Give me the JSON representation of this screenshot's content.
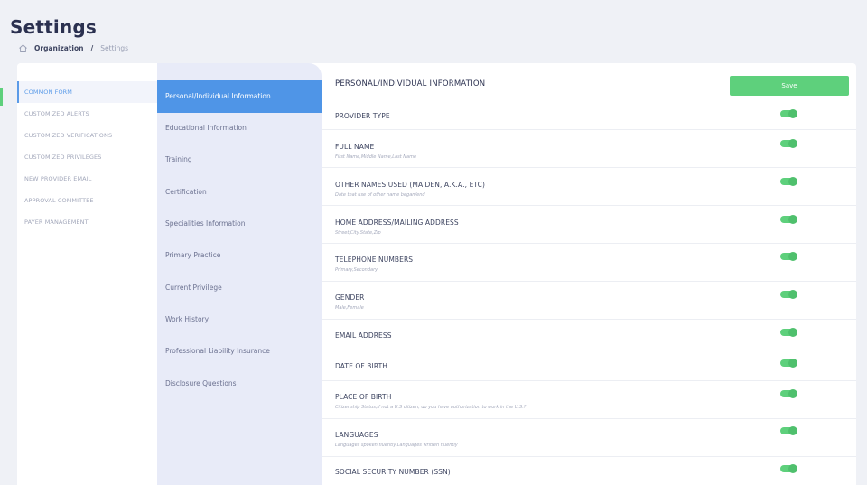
{
  "page": {
    "title": "Settings"
  },
  "breadcrumb": {
    "home_icon": "home-icon",
    "org": "Organization",
    "separator": "/",
    "current": "Settings"
  },
  "colors": {
    "accent_blue": "#4f95e7",
    "accent_green": "#5ed07c"
  },
  "sidebar": {
    "items": [
      {
        "label": "COMMON FORM",
        "active": true
      },
      {
        "label": "CUSTOMIZED ALERTS"
      },
      {
        "label": "CUSTOMIZED VERIFICATIONS"
      },
      {
        "label": "CUSTOMIZED PRIVILEGES"
      },
      {
        "label": "NEW PROVIDER EMAIL"
      },
      {
        "label": "APPROVAL COMMITTEE"
      },
      {
        "label": "PAYER MANAGEMENT"
      }
    ]
  },
  "sections": {
    "items": [
      {
        "label": "Personal/Individual Information",
        "active": true
      },
      {
        "label": "Educational Information"
      },
      {
        "label": "Training"
      },
      {
        "label": "Certification"
      },
      {
        "label": "Specialities Information"
      },
      {
        "label": "Primary Practice"
      },
      {
        "label": "Current Privilege"
      },
      {
        "label": "Work History"
      },
      {
        "label": "Professional Liability Insurance"
      },
      {
        "label": "Disclosure Questions"
      }
    ]
  },
  "main": {
    "title": "PERSONAL/INDIVIDUAL INFORMATION",
    "save_label": "Save",
    "fields": [
      {
        "label": "PROVIDER TYPE",
        "sub": "",
        "enabled": true
      },
      {
        "label": "FULL NAME",
        "sub": "First Name,Middle Name,Last Name",
        "enabled": true
      },
      {
        "label": "OTHER NAMES USED (MAIDEN, A.K.A., ETC)",
        "sub": "Date that use of other name began/end",
        "enabled": true
      },
      {
        "label": "HOME ADDRESS/MAILING ADDRESS",
        "sub": "Street,City,State,Zip",
        "enabled": true
      },
      {
        "label": "TELEPHONE NUMBERS",
        "sub": "Primary,Secondary",
        "enabled": true
      },
      {
        "label": "GENDER",
        "sub": "Male,Female",
        "enabled": true
      },
      {
        "label": "EMAIL ADDRESS",
        "sub": "",
        "enabled": true
      },
      {
        "label": "DATE OF BIRTH",
        "sub": "",
        "enabled": true
      },
      {
        "label": "PLACE OF BIRTH",
        "sub": "Citizenship Status,If not a U.S citizen, do you have authorization to work in the U.S.?",
        "enabled": true
      },
      {
        "label": "LANGUAGES",
        "sub": "Languages spoken fluently,Languages written fluently",
        "enabled": true
      },
      {
        "label": "SOCIAL SECURITY NUMBER (SSN)",
        "sub": "",
        "enabled": true
      }
    ]
  }
}
